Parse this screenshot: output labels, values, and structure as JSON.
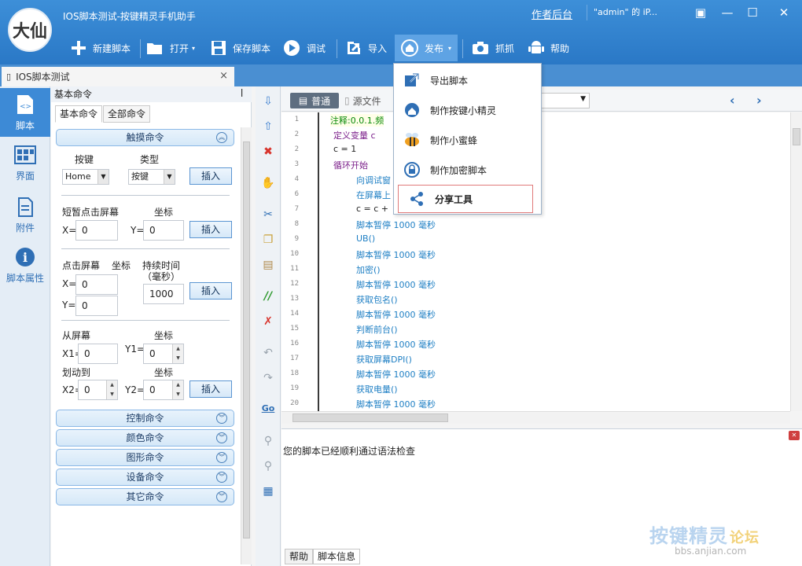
{
  "window": {
    "title": "IOS脚本测试-按键精灵手机助手",
    "logo_text": "大仙",
    "author_link": "作者后台",
    "user": "\"admin\" 的 iP...",
    "controls": [
      "▣",
      "—",
      "☐",
      "✕"
    ]
  },
  "toolbar": {
    "new_script": "新建脚本",
    "open": "打开",
    "save_script": "保存脚本",
    "debug": "调试",
    "import": "导入",
    "publish": "发布",
    "capture": "抓抓",
    "help": "帮助"
  },
  "doc_tab": {
    "label": "IOS脚本测试",
    "close": "×"
  },
  "leftnav": [
    {
      "label": "脚本",
      "icon": "script-icon"
    },
    {
      "label": "界面",
      "icon": "layout-icon"
    },
    {
      "label": "附件",
      "icon": "attachment-icon"
    },
    {
      "label": "脚本属性",
      "icon": "info-icon"
    }
  ],
  "commands": {
    "header": "基本命令",
    "pin": "ꟾ",
    "tabs": [
      "基本命令",
      "全部命令"
    ],
    "touch_group": "触摸命令",
    "key_label": "按键",
    "type_label": "类型",
    "key_value": "Home",
    "type_value": "按键",
    "insert": "插入",
    "short_click": "短暂点击屏幕",
    "coord": "坐标",
    "x_eq": "X=",
    "y_eq": "Y=",
    "x_val": "0",
    "y_val": "0",
    "click_screen": "点击屏幕",
    "duration": "持续时间",
    "duration_unit": "（毫秒）",
    "duration_val": "1000",
    "from_screen": "从屏幕",
    "x1": "X1=",
    "y1": "Y1=",
    "swipe_to": "划动到",
    "x2": "X2=",
    "y2": "Y2=",
    "groups": [
      "控制命令",
      "颜色命令",
      "图形命令",
      "设备命令",
      "其它命令"
    ]
  },
  "editor": {
    "mode_normal": "普通",
    "mode_source": "源文件",
    "lines": [
      {
        "n": "1",
        "text": "注释:0.0.1.频",
        "color": "#0a8a0a",
        "indent": 0
      },
      {
        "n": "2",
        "text": "定义变量 c",
        "color": "#7b1f8a",
        "indent": 0
      },
      {
        "n": "2",
        "text": "c = 1",
        "color": "#222222",
        "indent": 0
      },
      {
        "n": "3",
        "text": "循环开始",
        "color": "#7b1f8a",
        "indent": 0
      },
      {
        "n": "4",
        "text": "向调试窗",
        "color": "#1e7fc4",
        "indent": 1
      },
      {
        "n": "6",
        "text": "在屏幕上",
        "color": "#1e7fc4",
        "indent": 1
      },
      {
        "n": "7",
        "text": "c = c +",
        "color": "#222222",
        "indent": 1
      },
      {
        "n": "8",
        "text": "脚本暂停 1000 毫秒",
        "color": "#1e7fc4",
        "indent": 1
      },
      {
        "n": "9",
        "text": "UB()",
        "color": "#1e7fc4",
        "indent": 1
      },
      {
        "n": "10",
        "text": "脚本暂停 1000 毫秒",
        "color": "#1e7fc4",
        "indent": 1
      },
      {
        "n": "11",
        "text": "加密()",
        "color": "#1e7fc4",
        "indent": 1
      },
      {
        "n": "12",
        "text": "脚本暂停 1000 毫秒",
        "color": "#1e7fc4",
        "indent": 1
      },
      {
        "n": "13",
        "text": "获取包名()",
        "color": "#1e7fc4",
        "indent": 1
      },
      {
        "n": "14",
        "text": "脚本暂停 1000 毫秒",
        "color": "#1e7fc4",
        "indent": 1
      },
      {
        "n": "15",
        "text": "判断前台()",
        "color": "#1e7fc4",
        "indent": 1
      },
      {
        "n": "16",
        "text": "脚本暂停 1000 毫秒",
        "color": "#1e7fc4",
        "indent": 1
      },
      {
        "n": "17",
        "text": "获取屏幕DPI()",
        "color": "#1e7fc4",
        "indent": 1
      },
      {
        "n": "18",
        "text": "脚本暂停 1000 毫秒",
        "color": "#1e7fc4",
        "indent": 1
      },
      {
        "n": "19",
        "text": "获取电量()",
        "color": "#1e7fc4",
        "indent": 1
      },
      {
        "n": "20",
        "text": "脚本暂停 1000 毫秒",
        "color": "#1e7fc4",
        "indent": 1
      }
    ]
  },
  "output": {
    "message": "您的脚本已经顺利通过语法检查",
    "tabs": [
      "帮助",
      "脚本信息"
    ]
  },
  "watermark": {
    "title": "按键精灵",
    "suffix": "论坛",
    "url": "bbs.anjian.com"
  },
  "publish_menu": [
    {
      "label": "导出脚本",
      "icon": "export-icon"
    },
    {
      "label": "制作按键小精灵",
      "icon": "spirit-icon"
    },
    {
      "label": "制作小蜜蜂",
      "icon": "bee-icon"
    },
    {
      "label": "制作加密脚本",
      "icon": "lock-icon"
    },
    {
      "label": "分享工具",
      "icon": "share-icon"
    }
  ],
  "colors": {
    "titlebar": "#2f80cc",
    "accent": "#3d8ad6",
    "share_border": "#e07a7a"
  }
}
